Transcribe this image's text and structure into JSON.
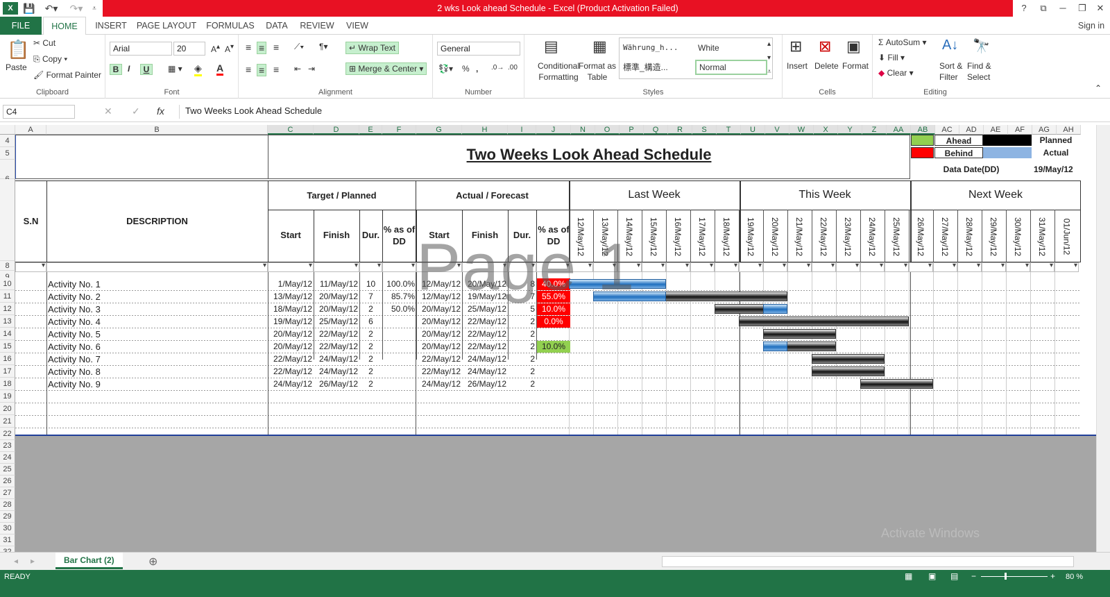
{
  "app": {
    "title": "2 wks Look ahead Schedule -  Excel (Product Activation Failed)",
    "sign_in": "Sign in",
    "help": "?",
    "minimize": "─",
    "restore": "❐",
    "close": "✕",
    "ribbon_opts": "⧉"
  },
  "tabs": [
    "FILE",
    "HOME",
    "INSERT",
    "PAGE LAYOUT",
    "FORMULAS",
    "DATA",
    "REVIEW",
    "VIEW"
  ],
  "ribbon": {
    "clipboard": {
      "paste": "Paste",
      "cut": "Cut",
      "copy": "Copy",
      "format_painter": "Format Painter",
      "label": "Clipboard"
    },
    "font": {
      "name": "Arial",
      "size": "20",
      "label": "Font",
      "bold": "B",
      "italic": "I",
      "underline": "U"
    },
    "alignment": {
      "wrap": "Wrap Text",
      "merge": "Merge & Center",
      "label": "Alignment"
    },
    "number": {
      "format": "General",
      "label": "Number",
      "pct": "%",
      "comma": ","
    },
    "styles": {
      "cond": "Conditional",
      "cond2": "Formatting",
      "fmt_table": "Format as",
      "fmt_table2": "Table",
      "s1": "Währung_h...",
      "s2": "White",
      "s3": "標準_構造...",
      "s4": "Normal",
      "label": "Styles"
    },
    "cells": {
      "insert": "Insert",
      "delete": "Delete",
      "format": "Format",
      "label": "Cells"
    },
    "editing": {
      "autosum": "AutoSum",
      "fill": "Fill",
      "clear": "Clear",
      "sort": "Sort &",
      "sort2": "Filter",
      "find": "Find &",
      "find2": "Select",
      "label": "Editing"
    }
  },
  "formula_bar": {
    "name_box": "C4",
    "fx": "fx",
    "content": "Two Weeks Look Ahead Schedule"
  },
  "columns": [
    "A",
    "B",
    "C",
    "D",
    "E",
    "F",
    "G",
    "H",
    "I",
    "J",
    "N",
    "O",
    "P",
    "Q",
    "R",
    "S",
    "T",
    "U",
    "V",
    "W",
    "X",
    "Y",
    "Z",
    "AA",
    "AB",
    "AC",
    "AD",
    "AE",
    "AF",
    "AG",
    "AH"
  ],
  "rows": [
    "4",
    "5",
    "6",
    "7",
    "8",
    "9",
    "10",
    "11",
    "12",
    "13",
    "14",
    "15",
    "16",
    "17",
    "18",
    "19",
    "20",
    "21",
    "22",
    "23",
    "24",
    "25",
    "26",
    "27",
    "28",
    "29",
    "30",
    "31",
    "32"
  ],
  "sheet": {
    "title": "Two Weeks Look Ahead Schedule",
    "legend": {
      "ahead": "Ahead",
      "behind": "Behind",
      "planned": "Planned",
      "actual": "Actual",
      "data_date_label": "Data Date(DD)",
      "data_date": "19/May/12"
    },
    "headers": {
      "sn": "S.N",
      "desc": "DESCRIPTION",
      "target": "Target / Planned",
      "actual": "Actual / Forecast",
      "start": "Start",
      "finish": "Finish",
      "dur": "Dur.",
      "pct": "% as of DD",
      "last_week": "Last Week",
      "this_week": "This Week",
      "next_week": "Next Week"
    },
    "dates": [
      "12/May/12",
      "13/May/12",
      "14/May/12",
      "15/May/12",
      "16/May/12",
      "17/May/12",
      "18/May/12",
      "19/May/12",
      "20/May/12",
      "21/May/12",
      "22/May/12",
      "23/May/12",
      "24/May/12",
      "25/May/12",
      "26/May/12",
      "27/May/12",
      "28/May/12",
      "29/May/12",
      "30/May/12",
      "31/May/12",
      "01/Jun/12"
    ],
    "activities": [
      {
        "desc": "Activity No. 1",
        "ps": "1/May/12",
        "pf": "11/May/12",
        "pd": "10",
        "pp": "100.0%",
        "as": "12/May/12",
        "af": "20/May/12",
        "ad": "8",
        "ap": "40.0%"
      },
      {
        "desc": "Activity No. 2",
        "ps": "13/May/12",
        "pf": "20/May/12",
        "pd": "7",
        "pp": "85.7%",
        "as": "12/May/12",
        "af": "19/May/12",
        "ad": "7",
        "ap": "55.0%"
      },
      {
        "desc": "Activity No. 3",
        "ps": "18/May/12",
        "pf": "20/May/12",
        "pd": "2",
        "pp": "50.0%",
        "as": "20/May/12",
        "af": "25/May/12",
        "ad": "5",
        "ap": "10.0%"
      },
      {
        "desc": "Activity No. 4",
        "ps": "19/May/12",
        "pf": "25/May/12",
        "pd": "6",
        "pp": "",
        "as": "20/May/12",
        "af": "22/May/12",
        "ad": "2",
        "ap": "0.0%"
      },
      {
        "desc": "Activity No. 5",
        "ps": "20/May/12",
        "pf": "22/May/12",
        "pd": "2",
        "pp": "",
        "as": "20/May/12",
        "af": "22/May/12",
        "ad": "2",
        "ap": ""
      },
      {
        "desc": "Activity No. 6",
        "ps": "20/May/12",
        "pf": "22/May/12",
        "pd": "2",
        "pp": "",
        "as": "20/May/12",
        "af": "22/May/12",
        "ad": "2",
        "ap": "10.0%"
      },
      {
        "desc": "Activity No. 7",
        "ps": "22/May/12",
        "pf": "24/May/12",
        "pd": "2",
        "pp": "",
        "as": "22/May/12",
        "af": "24/May/12",
        "ad": "2",
        "ap": ""
      },
      {
        "desc": "Activity No. 8",
        "ps": "22/May/12",
        "pf": "24/May/12",
        "pd": "2",
        "pp": "",
        "as": "22/May/12",
        "af": "24/May/12",
        "ad": "2",
        "ap": ""
      },
      {
        "desc": "Activity No. 9",
        "ps": "24/May/12",
        "pf": "26/May/12",
        "pd": "2",
        "pp": "",
        "as": "24/May/12",
        "af": "26/May/12",
        "ad": "2",
        "ap": ""
      }
    ],
    "watermark": "Page 1",
    "activate": "Activate Windows"
  },
  "sheet_tab": "Bar Chart (2)",
  "status": {
    "ready": "READY",
    "zoom": "80 %"
  },
  "colors": {
    "excel_green": "#217346",
    "red": "#e81123",
    "ahead": "#92d050",
    "behind": "#ff0000",
    "actual_fill": "#8db4e2"
  }
}
